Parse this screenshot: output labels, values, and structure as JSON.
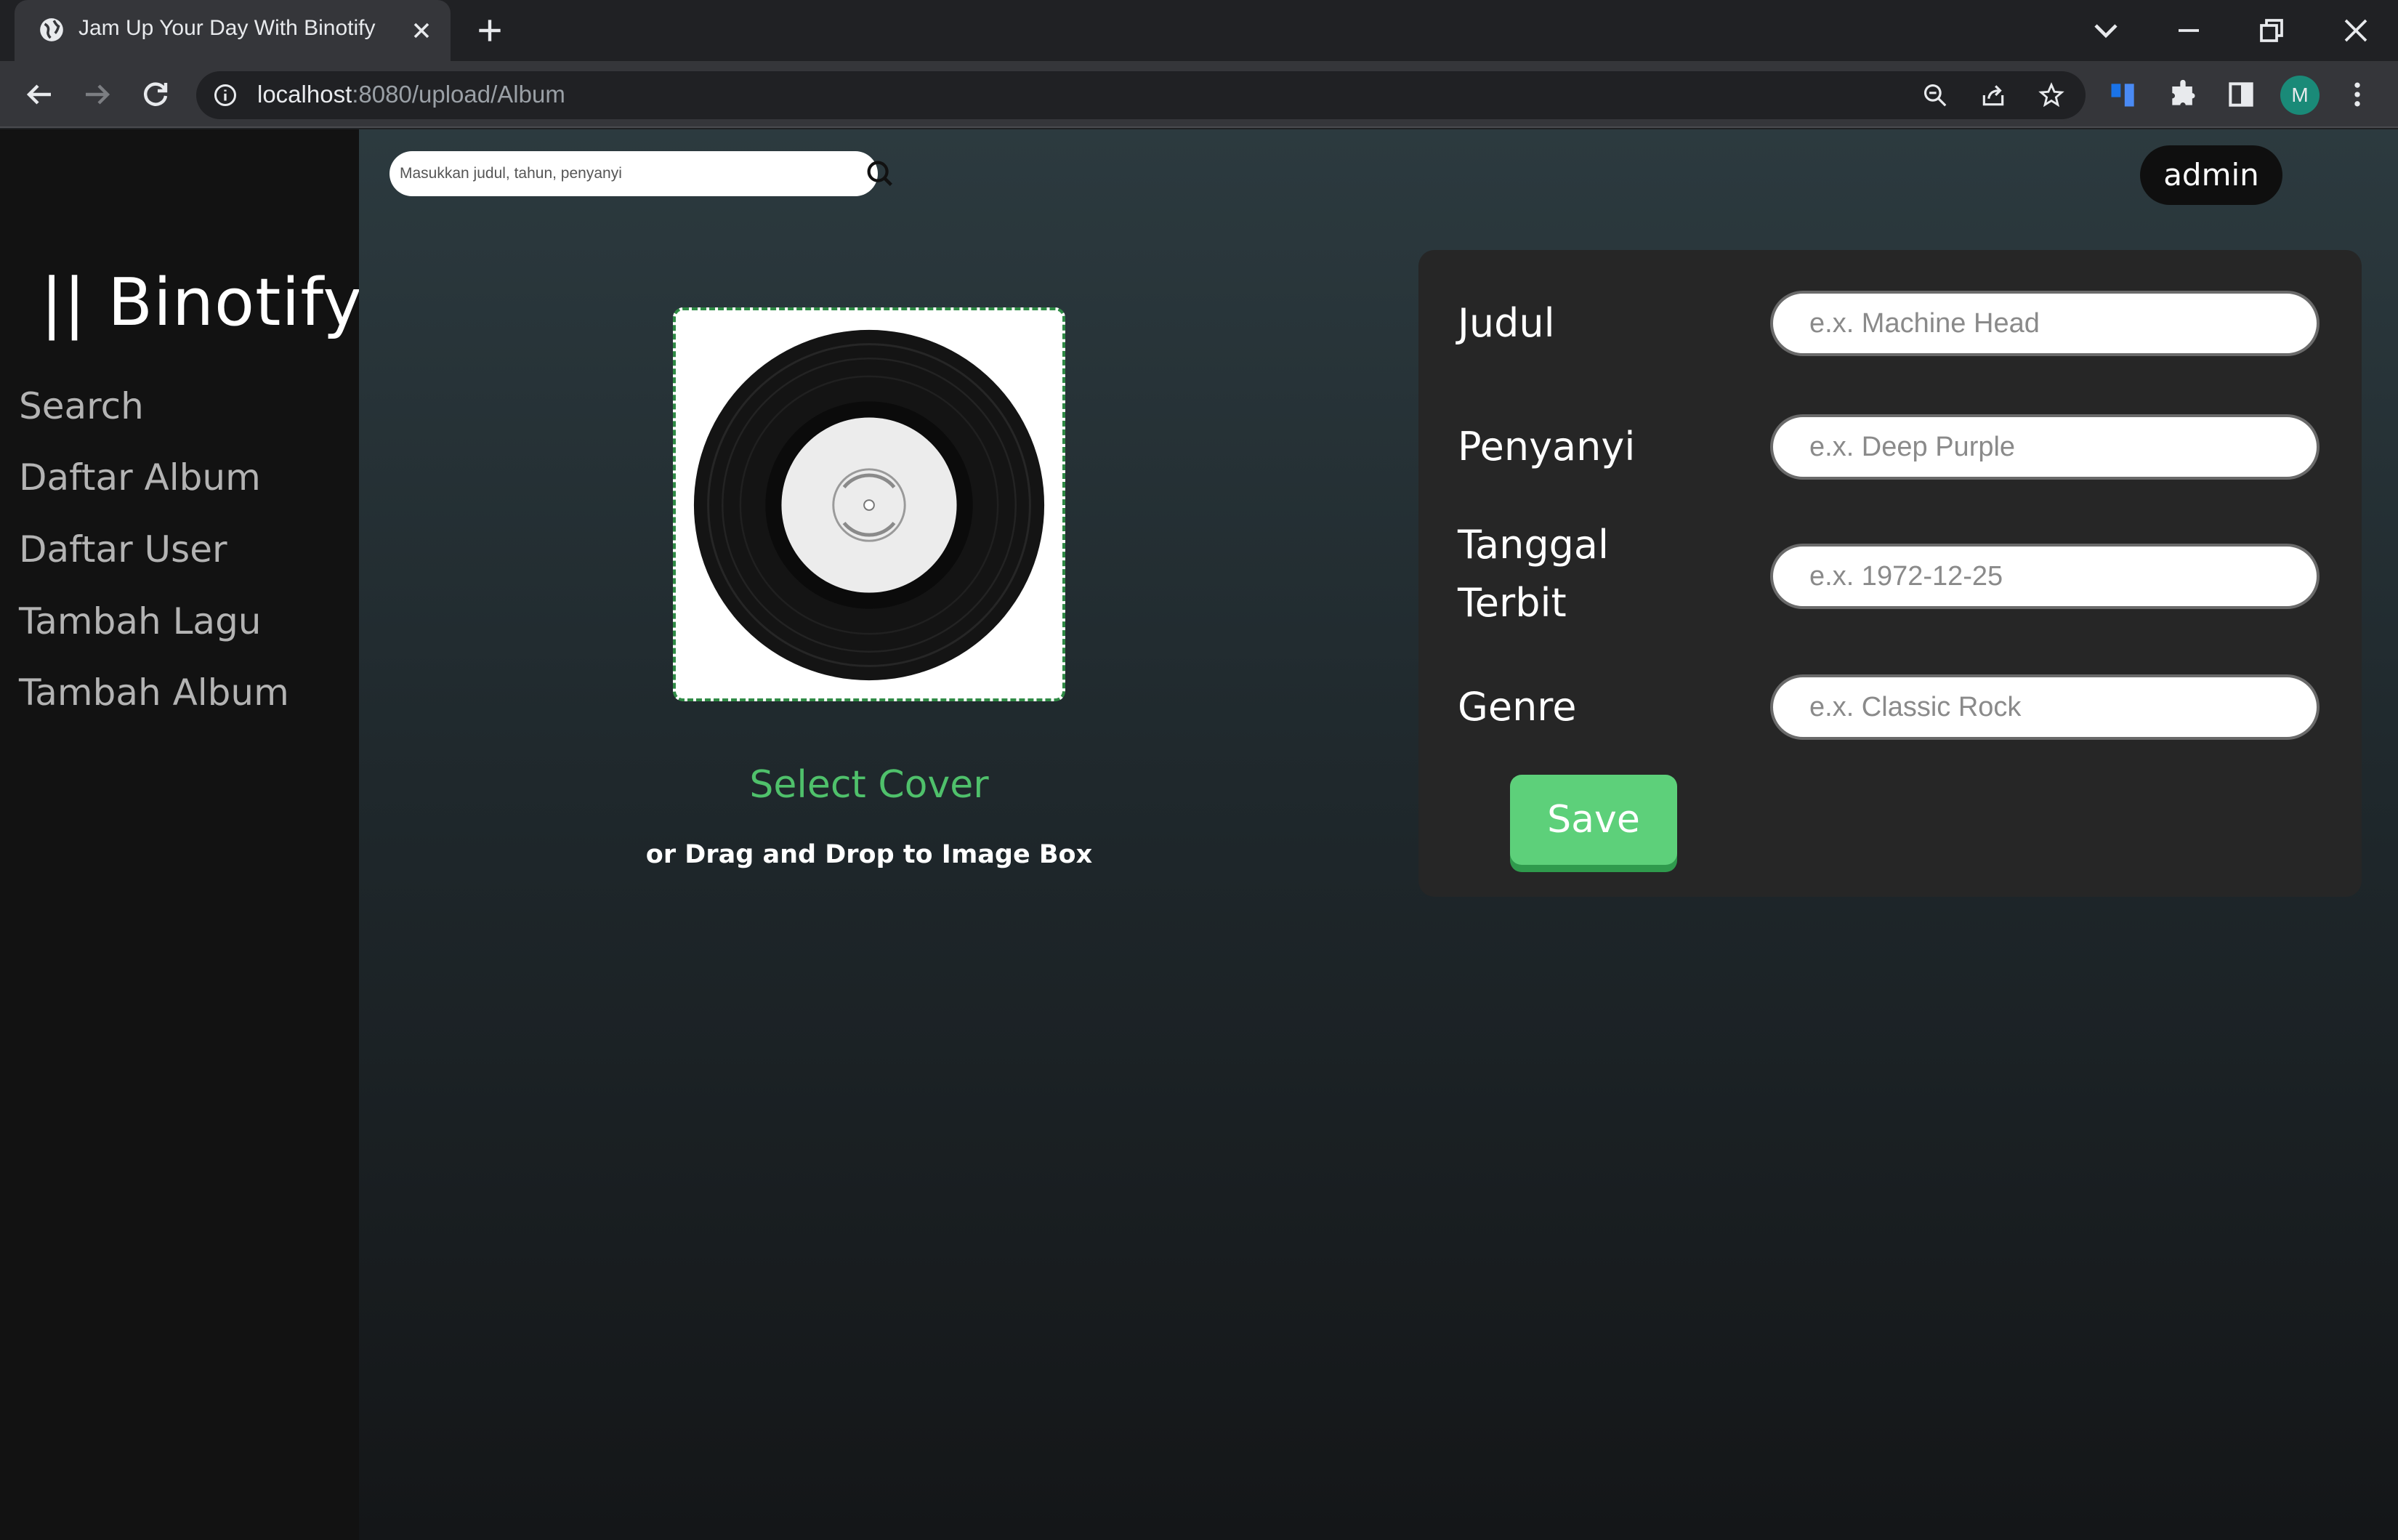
{
  "browser": {
    "tab_title": "Jam Up Your Day With Binotify",
    "url_host": "localhost",
    "url_path": ":8080/upload/Album",
    "profile_initial": "M"
  },
  "sidebar": {
    "brand": "|| Binotify",
    "items": [
      {
        "label": "Search"
      },
      {
        "label": "Daftar Album"
      },
      {
        "label": "Daftar User"
      },
      {
        "label": "Tambah Lagu"
      },
      {
        "label": "Tambah Album"
      }
    ]
  },
  "header": {
    "search_placeholder": "Masukkan judul, tahun, penyanyi",
    "user": "admin"
  },
  "cover": {
    "select_label": "Select Cover",
    "hint": "or Drag and Drop to Image Box"
  },
  "form": {
    "fields": [
      {
        "label": "Judul",
        "placeholder": "e.x. Machine Head"
      },
      {
        "label": "Penyanyi",
        "placeholder": "e.x. Deep Purple"
      },
      {
        "label_line1": "Tanggal",
        "label_line2": "Terbit",
        "placeholder": "e.x. 1972-12-25"
      },
      {
        "label": "Genre",
        "placeholder": "e.x. Classic Rock"
      }
    ],
    "save_label": "Save"
  },
  "colors": {
    "accent_green": "#4fc16b",
    "save_button": "#5dd07a",
    "sidebar_bg": "#121212",
    "panel_bg": "#262626"
  }
}
